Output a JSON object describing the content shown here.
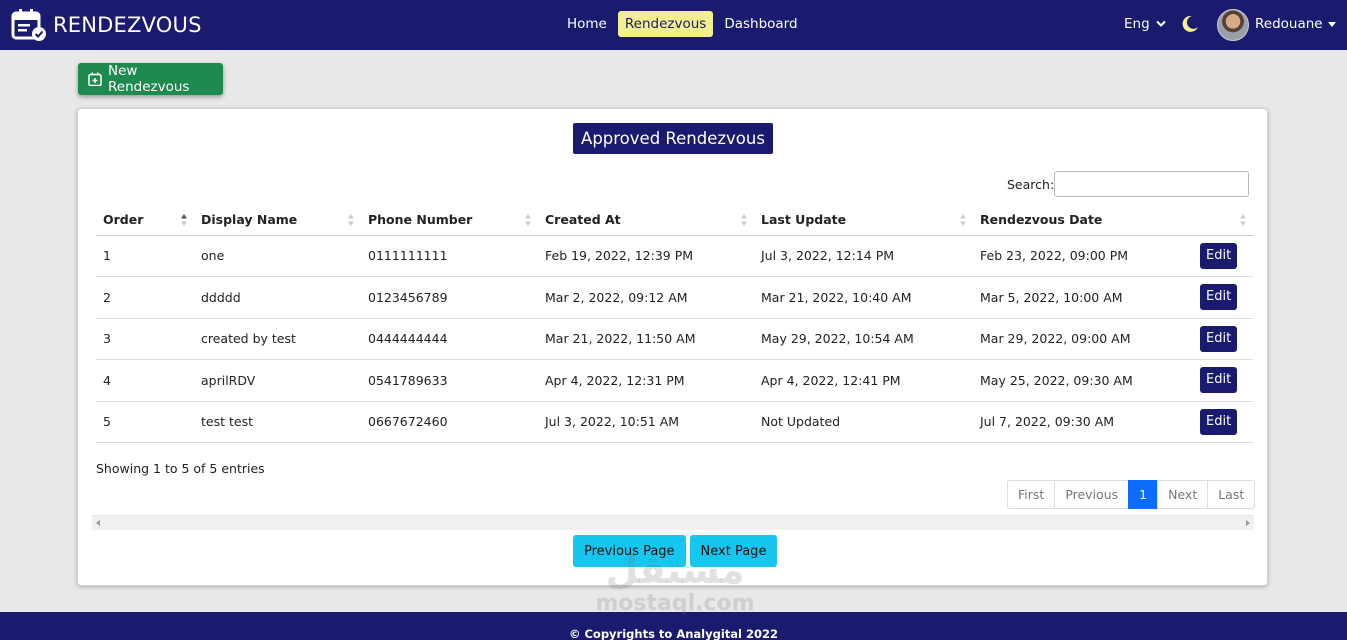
{
  "navbar": {
    "brand": "RENDEZVOUS",
    "links": [
      "Home",
      "Rendezvous",
      "Dashboard"
    ],
    "active_link": "Rendezvous",
    "language": "Eng",
    "user_name": "Redouane"
  },
  "actions": {
    "new_button": "New Rendezvous"
  },
  "card": {
    "title": "Approved Rendezvous",
    "search_label": "Search:",
    "search_value": "",
    "columns": [
      "Order",
      "Display Name",
      "Phone Number",
      "Created At",
      "Last Update",
      "Rendezvous Date",
      ""
    ],
    "rows": [
      {
        "order": "1",
        "name": "one",
        "phone": "0111111111",
        "created": "Feb 19, 2022, 12:39 PM",
        "updated": "Jul 3, 2022, 12:14 PM",
        "date": "Feb 23, 2022, 09:00 PM",
        "action": "Edit"
      },
      {
        "order": "2",
        "name": "ddddd",
        "phone": "0123456789",
        "created": "Mar 2, 2022, 09:12 AM",
        "updated": "Mar 21, 2022, 10:40 AM",
        "date": "Mar 5, 2022, 10:00 AM",
        "action": "Edit"
      },
      {
        "order": "3",
        "name": "created by test",
        "phone": "0444444444",
        "created": "Mar 21, 2022, 11:50 AM",
        "updated": "May 29, 2022, 10:54 AM",
        "date": "Mar 29, 2022, 09:00 AM",
        "action": "Edit"
      },
      {
        "order": "4",
        "name": "aprilRDV",
        "phone": "0541789633",
        "created": "Apr 4, 2022, 12:31 PM",
        "updated": "Apr 4, 2022, 12:41 PM",
        "date": "May 25, 2022, 09:30 AM",
        "action": "Edit"
      },
      {
        "order": "5",
        "name": "test test",
        "phone": "0667672460",
        "created": "Jul 3, 2022, 10:51 AM",
        "updated": "Not Updated",
        "date": "Jul 7, 2022, 09:30 AM",
        "action": "Edit"
      }
    ],
    "info": "Showing 1 to 5 of 5 entries",
    "pagination": [
      "First",
      "Previous",
      "1",
      "Next",
      "Last"
    ],
    "current_page": "1",
    "prev_page_button": "Previous Page",
    "next_page_button": "Next Page"
  },
  "footer": {
    "copyright": "© Copyrights to Analygital 2022"
  },
  "watermark": {
    "arabic": "مستقل",
    "latin": "mostaql.com"
  },
  "colors": {
    "navbar": "#1a1a6e",
    "active_link": "#f3ef8e",
    "new_button": "#1e8a4f",
    "page_buttons": "#17c6ee",
    "pagination_active": "#0d6efd"
  }
}
